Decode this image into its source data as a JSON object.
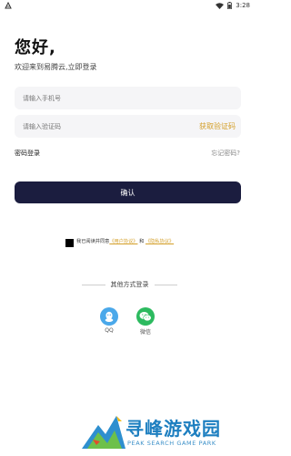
{
  "status_bar": {
    "time": "3:28"
  },
  "login": {
    "greeting": "您好,",
    "subtitle": "欢迎来到易腾云,立即登录",
    "phone_placeholder": "请输入手机号",
    "code_placeholder": "请输入验证码",
    "get_code": "获取验证码",
    "password_login": "密码登录",
    "forgot_password": "忘记密码?",
    "confirm": "确认"
  },
  "agreement": {
    "prefix": "我已阅读并同意",
    "user_agreement": "《用户协议》",
    "connector": "和",
    "privacy_agreement": "《隐私协议》"
  },
  "other_login": {
    "title": "其他方式登录",
    "options": [
      {
        "label": "QQ",
        "icon": "qq-icon",
        "color": "#4aa8ea"
      },
      {
        "label": "微信",
        "icon": "wechat-icon",
        "color": "#2cba5f"
      }
    ]
  },
  "watermark": {
    "title": "寻峰游戏园",
    "subtitle": "PEAK SEARCH GAME PARK"
  },
  "colors": {
    "accent": "#d4a02b",
    "button": "#1b1d3f",
    "field_bg": "#f5f5f7"
  }
}
